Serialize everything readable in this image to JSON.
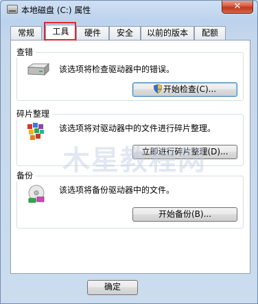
{
  "window": {
    "title": "本地磁盘 (C:) 属性",
    "close_label": "✕"
  },
  "tabs": [
    {
      "label": "常规",
      "active": false
    },
    {
      "label": "工具",
      "active": true
    },
    {
      "label": "硬件",
      "active": false
    },
    {
      "label": "安全",
      "active": false
    },
    {
      "label": "以前的版本",
      "active": false
    },
    {
      "label": "配额",
      "active": false
    }
  ],
  "groups": {
    "error_check": {
      "title": "查错",
      "description": "该选项将检查驱动器中的错误。",
      "button_label": "开始检查(C)...",
      "icon": "drive-icon"
    },
    "defrag": {
      "title": "碎片整理",
      "description": "该选项将对驱动器中的文件进行碎片整理。",
      "button_label": "立即进行碎片整理(D)...",
      "icon": "defrag-icon"
    },
    "backup": {
      "title": "备份",
      "description": "该选项将备份驱动器中的文件。",
      "button_label": "开始备份(B)...",
      "icon": "backup-icon"
    }
  },
  "footer": {
    "ok_label": "确定"
  },
  "watermark": "木星教程网",
  "colors": {
    "tab_highlight": "#e0262c",
    "close_button": "#c2381c"
  }
}
